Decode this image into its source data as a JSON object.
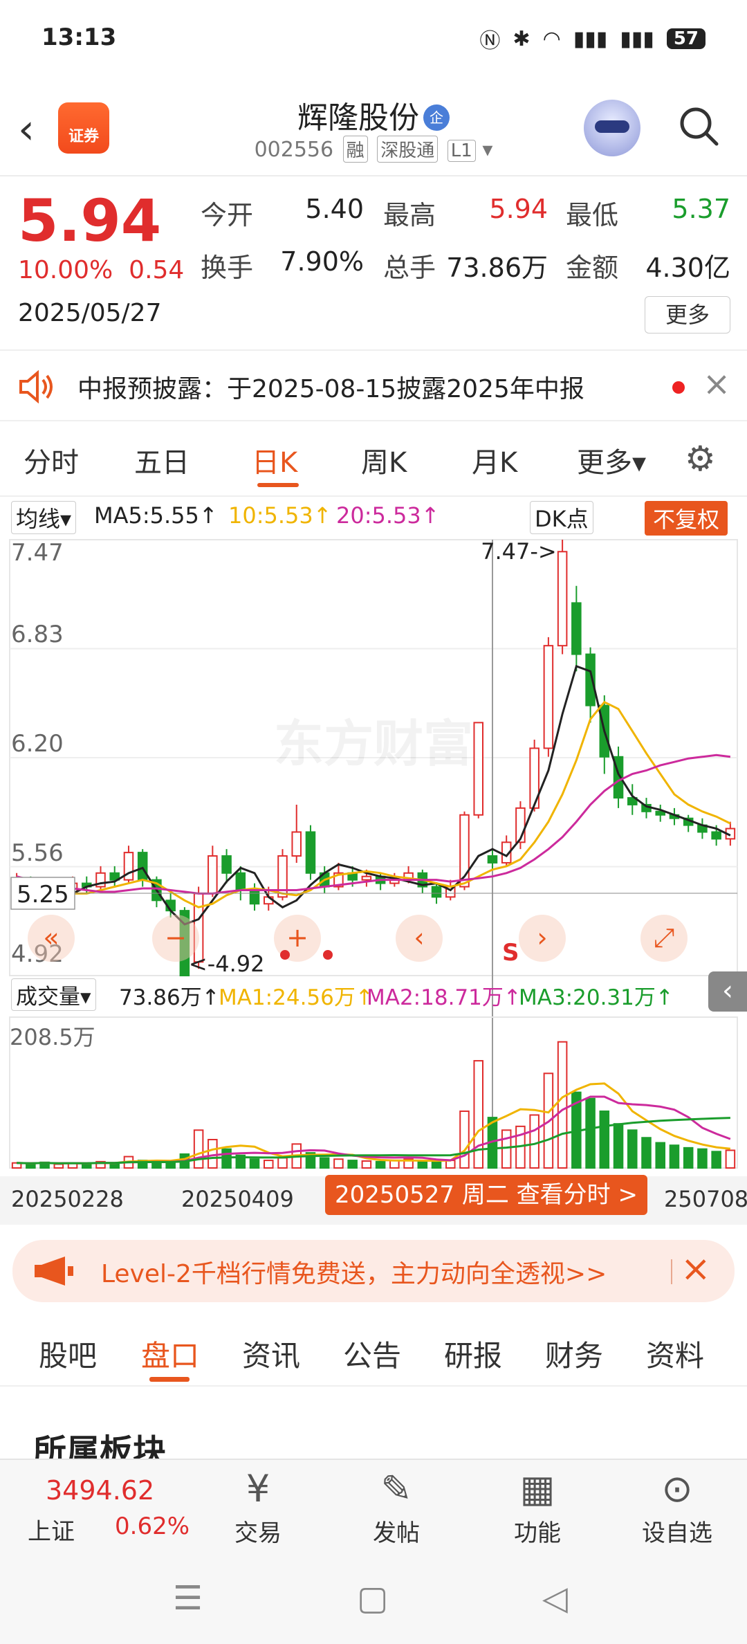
{
  "status": {
    "time": "13:13",
    "icons": [
      "nfc-icon",
      "bluetooth-icon",
      "wifi-icon",
      "signal-5g-icon",
      "signal-5g-icon"
    ],
    "battery": "57"
  },
  "header": {
    "stock_name": "辉隆股份",
    "corp_badge": "企",
    "code": "002556",
    "tags": [
      "融",
      "深股通",
      "L1"
    ],
    "app_logo_text": "证券"
  },
  "quote": {
    "price": "5.94",
    "change_pct": "10.00%",
    "change": "0.54",
    "date": "2025/05/27",
    "open_label": "今开",
    "open": "5.40",
    "high_label": "最高",
    "high": "5.94",
    "low_label": "最低",
    "low": "5.37",
    "turnover_label": "换手",
    "turnover": "7.90%",
    "volume_label": "总手",
    "volume": "73.86万",
    "amount_label": "金额",
    "amount": "4.30亿",
    "more": "更多"
  },
  "notice": {
    "text": "中报预披露：于2025-08-15披露2025年中报"
  },
  "chart_tabs": [
    "分时",
    "五日",
    "日K",
    "周K",
    "月K",
    "更多▾"
  ],
  "ma_bar": {
    "select": "均线▾",
    "ma5": "MA5:5.55↑",
    "ma10": "10:5.53↑",
    "ma20": "20:5.53↑",
    "dk": "DK点",
    "fq": "不复权"
  },
  "kline": {
    "y_labels": [
      "7.47",
      "6.83",
      "6.20",
      "5.56",
      "4.92"
    ],
    "current_label": "5.25",
    "low_marker": "<-4.92",
    "high_marker": "7.47->",
    "signal": "S",
    "watermark": "东方财富"
  },
  "volume_bar": {
    "select": "成交量▾",
    "vol": "73.86万↑",
    "ma1": "MA1:24.56万↑",
    "ma2": "MA2:18.71万↑",
    "ma3": "MA3:20.31万↑",
    "max_label": "208.5万"
  },
  "date_axis": {
    "d1": "20250228",
    "d2": "20250409",
    "d3": "250708",
    "popup": "20250527 周二 查看分时 >"
  },
  "promo": {
    "text": "Level-2千档行情免费送，主力动向全透视>>"
  },
  "sub_tabs": [
    "股吧",
    "盘口",
    "资讯",
    "公告",
    "研报",
    "财务",
    "资料"
  ],
  "section_title": "所属板块",
  "index": {
    "value": "3494.62",
    "name": "上证",
    "pct": "0.62%"
  },
  "tools": [
    "交易",
    "发帖",
    "功能",
    "设自选"
  ],
  "colors": {
    "up": "#e02d2d",
    "down": "#1a9d2c",
    "accent": "#e8561e",
    "ma5": "#222222",
    "ma10": "#f0b400",
    "ma20": "#cc2a9c"
  },
  "chart_data": {
    "type": "candlestick",
    "ylim": [
      4.92,
      7.47
    ],
    "series": [
      {
        "name": "MA5",
        "values": [
          5.42,
          5.45,
          5.4,
          5.38,
          5.4,
          5.44,
          5.46,
          5.47,
          5.52,
          5.55,
          5.42,
          5.3,
          5.22,
          5.25,
          5.36,
          5.47,
          5.55,
          5.52,
          5.38,
          5.32,
          5.36,
          5.45,
          5.52,
          5.57,
          5.55,
          5.52,
          5.5,
          5.49,
          5.47,
          5.45,
          5.46,
          5.42,
          5.5,
          5.62,
          5.66,
          5.62,
          5.72,
          5.92,
          6.12,
          6.45,
          6.73,
          6.7,
          6.35,
          6.1,
          5.97,
          5.91,
          5.89,
          5.86,
          5.83,
          5.8,
          5.78,
          5.74
        ]
      },
      {
        "name": "MA10",
        "values": [
          5.45,
          5.43,
          5.42,
          5.41,
          5.4,
          5.4,
          5.42,
          5.44,
          5.46,
          5.48,
          5.46,
          5.41,
          5.36,
          5.32,
          5.34,
          5.39,
          5.42,
          5.43,
          5.42,
          5.4,
          5.39,
          5.42,
          5.48,
          5.51,
          5.52,
          5.53,
          5.52,
          5.5,
          5.49,
          5.48,
          5.46,
          5.44,
          5.46,
          5.5,
          5.54,
          5.56,
          5.6,
          5.7,
          5.82,
          5.98,
          6.18,
          6.42,
          6.52,
          6.48,
          6.35,
          6.22,
          6.1,
          5.98,
          5.92,
          5.88,
          5.85,
          5.81
        ]
      },
      {
        "name": "MA20",
        "values": [
          5.5,
          5.48,
          5.47,
          5.45,
          5.43,
          5.42,
          5.41,
          5.41,
          5.42,
          5.43,
          5.43,
          5.42,
          5.41,
          5.4,
          5.4,
          5.41,
          5.42,
          5.42,
          5.42,
          5.42,
          5.42,
          5.43,
          5.44,
          5.45,
          5.46,
          5.47,
          5.48,
          5.48,
          5.48,
          5.48,
          5.48,
          5.47,
          5.48,
          5.49,
          5.5,
          5.52,
          5.55,
          5.6,
          5.66,
          5.73,
          5.82,
          5.92,
          6.0,
          6.06,
          6.1,
          6.12,
          6.15,
          6.17,
          6.19,
          6.2,
          6.21,
          6.2
        ]
      }
    ],
    "candles": [
      {
        "o": 5.4,
        "c": 5.48,
        "h": 5.52,
        "l": 5.36
      },
      {
        "o": 5.48,
        "c": 5.42,
        "h": 5.5,
        "l": 5.38
      },
      {
        "o": 5.42,
        "c": 5.36,
        "h": 5.46,
        "l": 5.32
      },
      {
        "o": 5.36,
        "c": 5.4,
        "h": 5.44,
        "l": 5.32
      },
      {
        "o": 5.4,
        "c": 5.46,
        "h": 5.5,
        "l": 5.38
      },
      {
        "o": 5.46,
        "c": 5.44,
        "h": 5.5,
        "l": 5.4
      },
      {
        "o": 5.44,
        "c": 5.52,
        "h": 5.56,
        "l": 5.42
      },
      {
        "o": 5.52,
        "c": 5.48,
        "h": 5.56,
        "l": 5.44
      },
      {
        "o": 5.48,
        "c": 5.64,
        "h": 5.68,
        "l": 5.46
      },
      {
        "o": 5.64,
        "c": 5.48,
        "h": 5.66,
        "l": 5.44
      },
      {
        "o": 5.48,
        "c": 5.36,
        "h": 5.5,
        "l": 5.32
      },
      {
        "o": 5.36,
        "c": 5.3,
        "h": 5.4,
        "l": 5.26
      },
      {
        "o": 5.3,
        "c": 4.92,
        "h": 5.32,
        "l": 4.92
      },
      {
        "o": 5.0,
        "c": 5.4,
        "h": 5.44,
        "l": 4.96
      },
      {
        "o": 5.4,
        "c": 5.62,
        "h": 5.68,
        "l": 5.38
      },
      {
        "o": 5.62,
        "c": 5.52,
        "h": 5.66,
        "l": 5.46
      },
      {
        "o": 5.52,
        "c": 5.42,
        "h": 5.56,
        "l": 5.36
      },
      {
        "o": 5.42,
        "c": 5.34,
        "h": 5.46,
        "l": 5.3
      },
      {
        "o": 5.34,
        "c": 5.38,
        "h": 5.44,
        "l": 5.3
      },
      {
        "o": 5.38,
        "c": 5.62,
        "h": 5.66,
        "l": 5.36
      },
      {
        "o": 5.62,
        "c": 5.76,
        "h": 5.92,
        "l": 5.58
      },
      {
        "o": 5.76,
        "c": 5.52,
        "h": 5.8,
        "l": 5.48
      },
      {
        "o": 5.52,
        "c": 5.44,
        "h": 5.56,
        "l": 5.4
      },
      {
        "o": 5.44,
        "c": 5.52,
        "h": 5.58,
        "l": 5.42
      },
      {
        "o": 5.52,
        "c": 5.48,
        "h": 5.56,
        "l": 5.44
      },
      {
        "o": 5.48,
        "c": 5.5,
        "h": 5.54,
        "l": 5.44
      },
      {
        "o": 5.5,
        "c": 5.46,
        "h": 5.52,
        "l": 5.42
      },
      {
        "o": 5.46,
        "c": 5.48,
        "h": 5.52,
        "l": 5.44
      },
      {
        "o": 5.48,
        "c": 5.52,
        "h": 5.56,
        "l": 5.46
      },
      {
        "o": 5.52,
        "c": 5.44,
        "h": 5.54,
        "l": 5.4
      },
      {
        "o": 5.44,
        "c": 5.38,
        "h": 5.46,
        "l": 5.34
      },
      {
        "o": 5.38,
        "c": 5.44,
        "h": 5.48,
        "l": 5.36
      },
      {
        "o": 5.44,
        "c": 5.86,
        "h": 5.88,
        "l": 5.42
      },
      {
        "o": 5.86,
        "c": 6.4,
        "h": 6.4,
        "l": 5.84
      },
      {
        "o": 5.62,
        "c": 5.58,
        "h": 5.66,
        "l": 5.54
      },
      {
        "o": 5.58,
        "c": 5.7,
        "h": 5.74,
        "l": 5.56
      },
      {
        "o": 5.7,
        "c": 5.9,
        "h": 5.94,
        "l": 5.66
      },
      {
        "o": 5.9,
        "c": 6.25,
        "h": 6.3,
        "l": 5.88
      },
      {
        "o": 6.25,
        "c": 6.85,
        "h": 6.9,
        "l": 6.2
      },
      {
        "o": 6.85,
        "c": 7.4,
        "h": 7.47,
        "l": 6.8
      },
      {
        "o": 7.1,
        "c": 6.8,
        "h": 7.2,
        "l": 6.7
      },
      {
        "o": 6.8,
        "c": 6.5,
        "h": 6.84,
        "l": 6.4
      },
      {
        "o": 6.5,
        "c": 6.2,
        "h": 6.56,
        "l": 6.1
      },
      {
        "o": 6.2,
        "c": 5.96,
        "h": 6.26,
        "l": 5.9
      },
      {
        "o": 5.96,
        "c": 5.92,
        "h": 6.04,
        "l": 5.86
      },
      {
        "o": 5.92,
        "c": 5.88,
        "h": 5.96,
        "l": 5.84
      },
      {
        "o": 5.88,
        "c": 5.86,
        "h": 5.92,
        "l": 5.82
      },
      {
        "o": 5.86,
        "c": 5.84,
        "h": 5.9,
        "l": 5.8
      },
      {
        "o": 5.84,
        "c": 5.8,
        "h": 5.86,
        "l": 5.76
      },
      {
        "o": 5.8,
        "c": 5.76,
        "h": 5.84,
        "l": 5.72
      },
      {
        "o": 5.76,
        "c": 5.72,
        "h": 5.8,
        "l": 5.68
      },
      {
        "o": 5.72,
        "c": 5.78,
        "h": 5.82,
        "l": 5.68
      }
    ],
    "volumes": [
      8,
      7,
      9,
      6,
      8,
      7,
      10,
      8,
      18,
      12,
      10,
      9,
      22,
      60,
      45,
      30,
      20,
      14,
      12,
      16,
      38,
      24,
      16,
      14,
      12,
      11,
      10,
      12,
      14,
      11,
      10,
      12,
      90,
      170,
      80,
      60,
      66,
      84,
      150,
      200,
      120,
      110,
      90,
      70,
      60,
      48,
      40,
      36,
      32,
      30,
      26,
      28
    ]
  }
}
